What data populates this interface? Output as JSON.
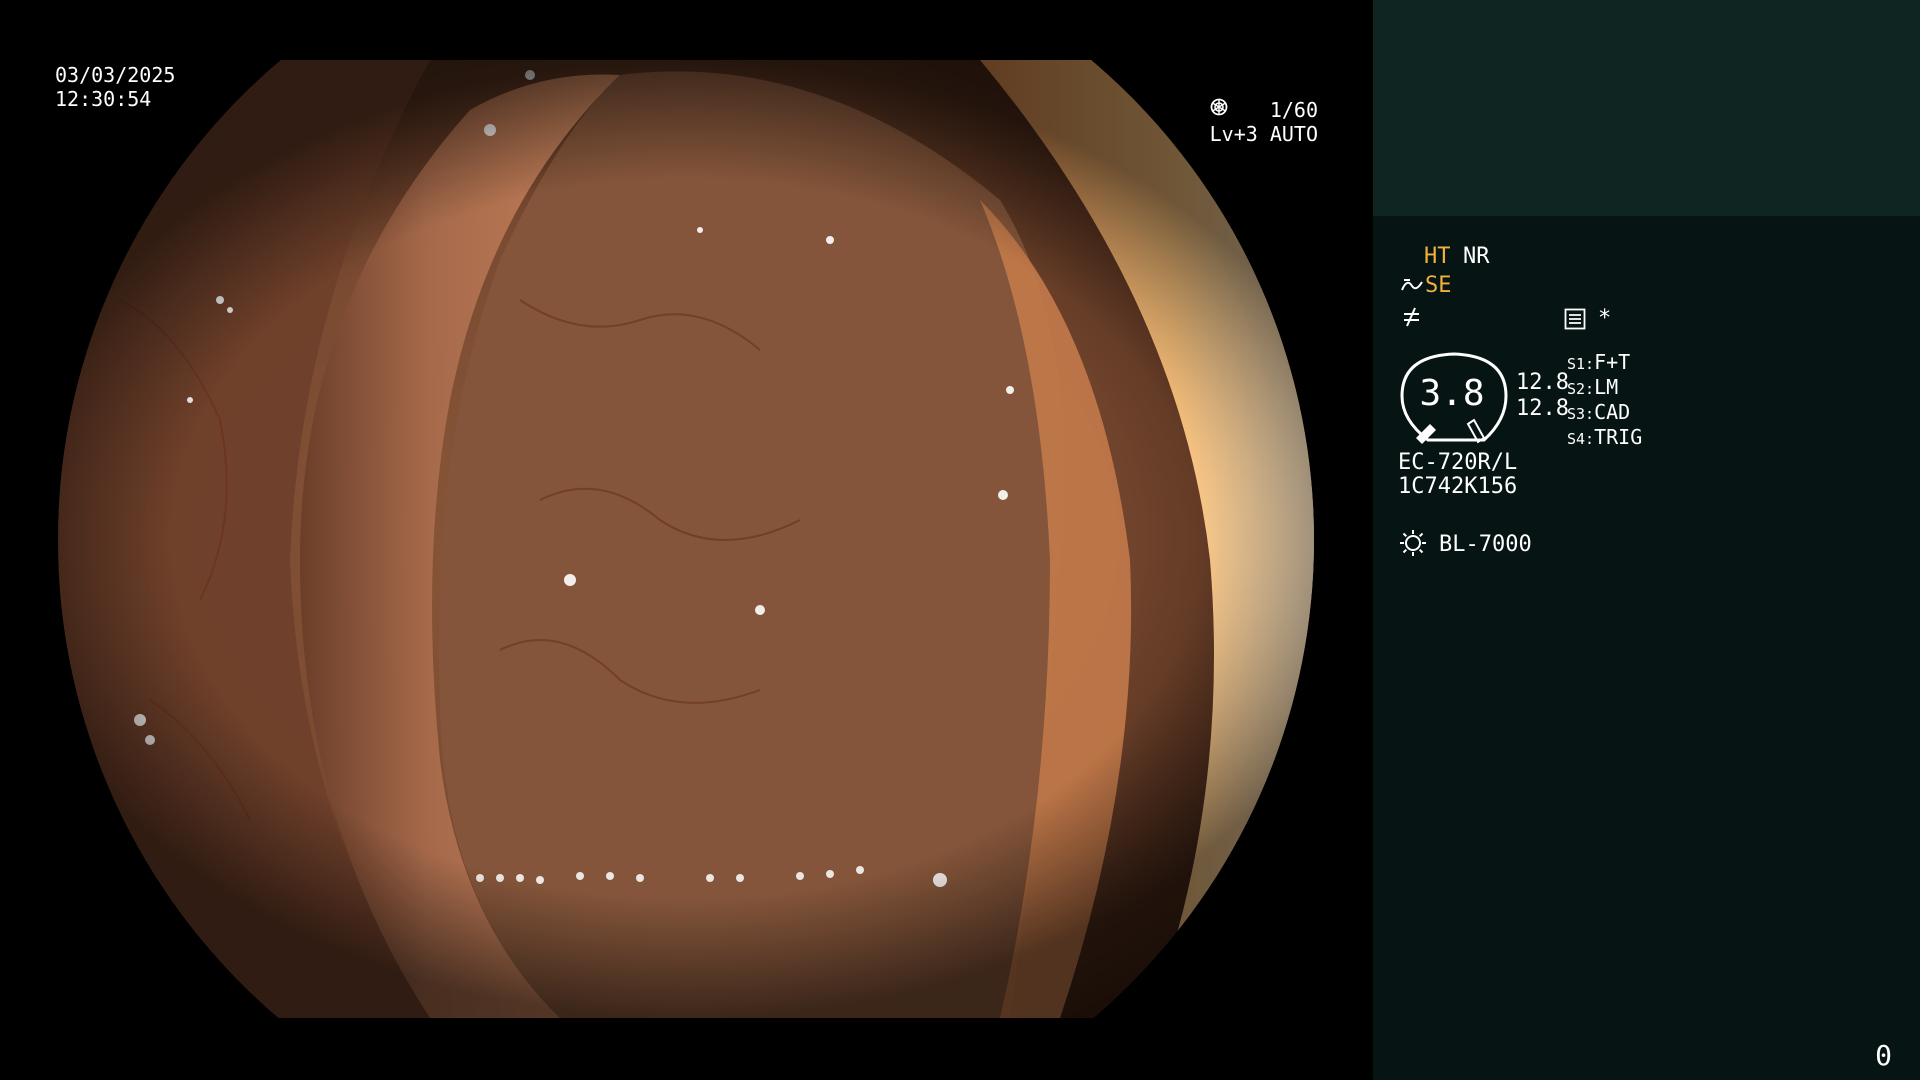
{
  "overlay": {
    "date": "03/03/2025",
    "time": "12:30:54",
    "shutter": "1/60",
    "shutter_icon": "iris-icon",
    "brightness": "Lv+3 AUTO",
    "brightness_icon": "auto-exposure-icon"
  },
  "panel": {
    "ht": "HT",
    "nr": "NR",
    "se": "SE",
    "se_icon": "fiber-icon",
    "dyn_icon": "not-equal-icon",
    "menu_icon": "menu-icon",
    "star": "*",
    "gauge_value": "3.8",
    "gauge_a": "12.8",
    "gauge_b": "12.8",
    "switches": [
      {
        "key": "S1:",
        "value": "F+T"
      },
      {
        "key": "S2:",
        "value": "LM"
      },
      {
        "key": "S3:",
        "value": "CAD"
      },
      {
        "key": "S4:",
        "value": "TRIG"
      }
    ],
    "scope_model": "EC-720R/L",
    "serial": "1C742K156",
    "light_icon": "lamp-icon",
    "light_model": "BL-7000",
    "counter": "0"
  },
  "colors": {
    "panel_top": "#0e2522",
    "panel_main": "#061413",
    "accent_orange": "#f0b23c",
    "text": "#ffffff"
  }
}
